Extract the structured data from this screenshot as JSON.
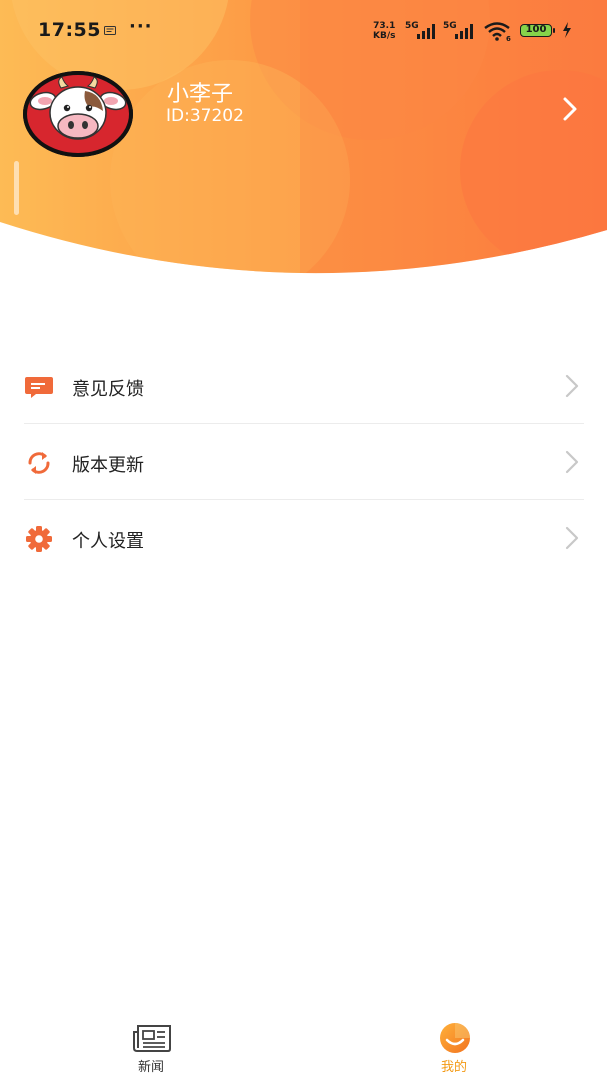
{
  "status_bar": {
    "time": "17:55",
    "dots": "···",
    "net_speed_value": "73.1",
    "net_speed_unit": "KB/s",
    "sim1_label": "5G",
    "sim2_label": "5G",
    "wifi_badge": "6",
    "battery": "100"
  },
  "profile": {
    "name": "小李子",
    "id": "ID:37202",
    "avatar": "cow-avatar"
  },
  "menu": {
    "items": [
      {
        "label": "意见反馈",
        "icon": "feedback-icon"
      },
      {
        "label": "版本更新",
        "icon": "refresh-icon"
      },
      {
        "label": "个人设置",
        "icon": "gear-icon"
      }
    ]
  },
  "tabs": [
    {
      "label": "新闻",
      "icon": "newspaper-icon",
      "active": false
    },
    {
      "label": "我的",
      "icon": "smile-icon",
      "active": true
    }
  ],
  "colors": {
    "accent": "#f37a3c",
    "header_light": "#fdb64e",
    "header_dark": "#fb7b3f",
    "tab_active": "#f39a16"
  }
}
